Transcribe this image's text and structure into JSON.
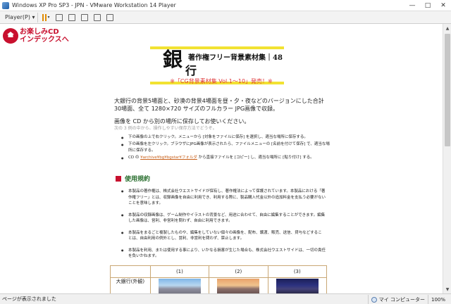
{
  "window": {
    "title": "Windows XP Pro SP3 - JPN - VMware Workstation 14 Player",
    "minimize": "—",
    "maximize": "□",
    "close": "✕"
  },
  "vm_toolbar": {
    "player_menu": "Player(P) ▾",
    "caret": "▾"
  },
  "home_link": {
    "line1": "お楽しみCD",
    "line2": "インデックスへ"
  },
  "banner": {
    "series": "著作権フリー背景素材集｜48",
    "big_char": "銀",
    "sub_char": "行"
  },
  "announcement": "※「CG背景素材集 Vol.1〜10」発売！※",
  "intro": "大銀行の背景5場面と、砂漠の背景4場面を昼・夕・夜などのバージョンにした合計30場面、全て 1280×720 サイズのフルカラー JPG画像で収録。",
  "save": {
    "note": "画像を CD から別の場所に保存してお使いください。",
    "sub": "次の 3 例の中から、操作しやすい保存方法でどうぞ。"
  },
  "save_methods": [
    "下の画像の上で右クリック。メニューから [対象をファイルに保存] を選択し、適当な場所に保存する。",
    "下の画像を左クリック。ブラウザにJPG画像が表示されたら、ファイルメニューの [名前を付けて保存] で、適当な場所に保存する。"
  ],
  "save_method_3": {
    "prefix": "CD の",
    "link": "¥archive¥bg¥bgstar¥フォルダ",
    "suffix": "から直接ファイルを [コピー] し、適当な場所に [貼り付け] する。"
  },
  "terms": {
    "heading": "使用規約",
    "items": [
      "本製品の著作権は、株式会社ウエストサイドが保有し、著作権法によって保護されています。本製品における「著作権フリー」とは、収録画像を自由に利用でき、利用する際に、製品購入代金以外の追加料金を支払う必要がないことを意味します。",
      "本製品の収録画像は、ゲーム制作やイラストの背景など、用途に合わせて、自由に編集することができます。編集した画像は、営利、非営利を問わず、自由に利用できます。",
      "本製品をまるごと複製したものや、編集をしていない個々の画像を、配布、譲渡、販売、送信、貸与などすることは、自由利用の例外とし、営利、非営利を問わず、禁止します。",
      "本製品を利用、または使用する事により、いかなる損害が生じた場合も、株式会社ウエストサイドは、一切の責任を負いかねます。"
    ]
  },
  "gallery": {
    "columns": [
      "",
      "(1)",
      "(2)",
      "(3)"
    ],
    "row_label": "大銀行(外観)"
  },
  "status": {
    "message": "ページが表示されました",
    "zone": "マイ コンピューター",
    "zoom": "100%"
  }
}
